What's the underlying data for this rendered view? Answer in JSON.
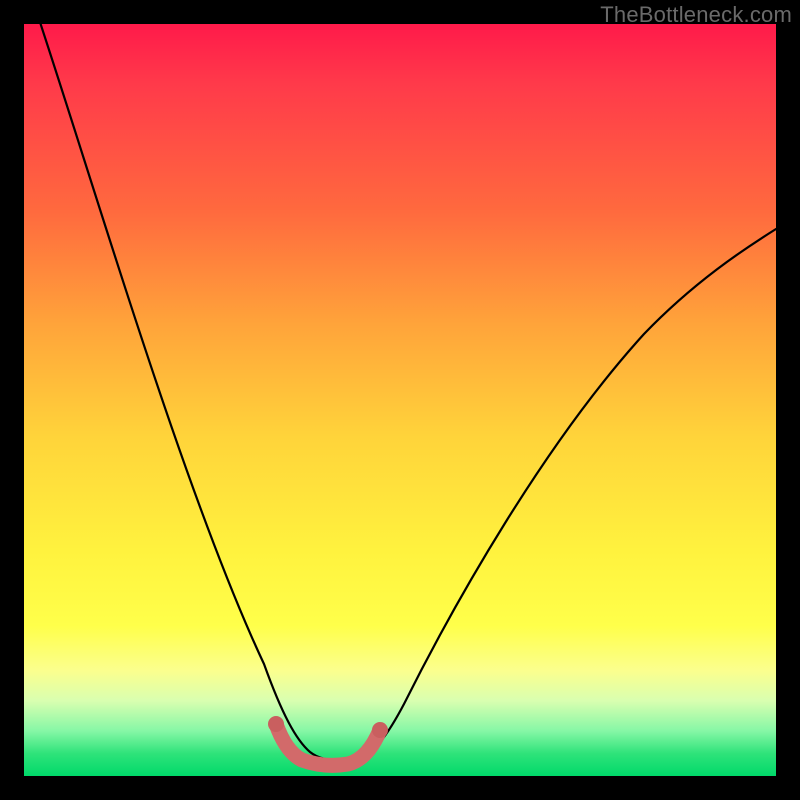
{
  "watermark": "TheBottleneck.com",
  "colors": {
    "background_frame": "#000000",
    "curve_stroke": "#000000",
    "valley_marker": "#d26a6a",
    "valley_marker_dot": "#c95f5f"
  },
  "chart_data": {
    "type": "line",
    "title": "",
    "xlabel": "",
    "ylabel": "",
    "xlim": [
      0,
      100
    ],
    "ylim": [
      0,
      100
    ],
    "grid": false,
    "legend": false,
    "series": [
      {
        "name": "bottleneck-curve",
        "x": [
          0,
          5,
          10,
          15,
          20,
          25,
          30,
          33,
          36,
          38,
          40,
          45,
          50,
          55,
          60,
          65,
          70,
          75,
          80,
          85,
          90,
          95,
          100
        ],
        "y": [
          103,
          88,
          73,
          58,
          44,
          30,
          16,
          6,
          1,
          0,
          0,
          1,
          6,
          13,
          20,
          27,
          34,
          41,
          47,
          53,
          58,
          63,
          67
        ]
      }
    ],
    "annotations": [
      {
        "name": "optimal-valley-marker",
        "x_range": [
          33,
          45
        ],
        "note": "thick pink U-shaped marker at curve minimum"
      }
    ]
  }
}
